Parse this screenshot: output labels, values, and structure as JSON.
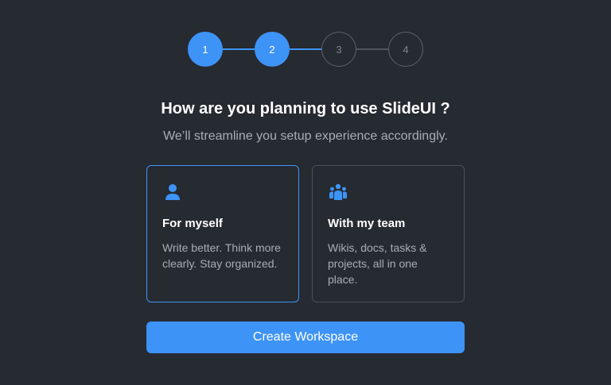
{
  "stepper": {
    "current_step": 2,
    "total_steps": 4,
    "steps": [
      {
        "label": "1",
        "state": "completed"
      },
      {
        "label": "2",
        "state": "current"
      },
      {
        "label": "3",
        "state": "upcoming"
      },
      {
        "label": "4",
        "state": "upcoming"
      }
    ]
  },
  "heading": {
    "title": "How are you planning to use SlideUI ?",
    "subtitle": "We’ll streamline you setup experience accordingly."
  },
  "options": [
    {
      "id": "myself",
      "title": "For myself",
      "description": "Write better. Think more clearly. Stay organized.",
      "icon": "user-icon",
      "selected": true
    },
    {
      "id": "team",
      "title": "With my team",
      "description": "Wikis, docs, tasks & projects, all in one place.",
      "icon": "team-icon",
      "selected": false
    }
  ],
  "actions": {
    "create_label": "Create Workspace"
  },
  "colors": {
    "background": "#262a31",
    "accent": "#3e93f7",
    "muted_text": "#a9adb4",
    "border": "#4b5058"
  }
}
